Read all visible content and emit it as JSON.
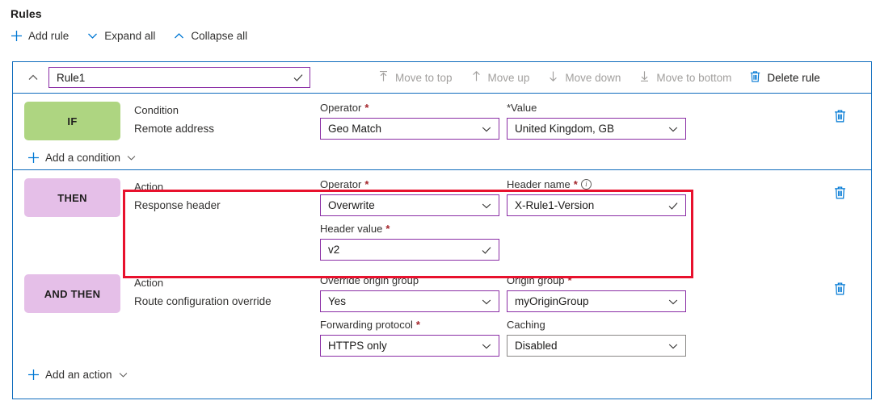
{
  "page": {
    "title": "Rules"
  },
  "command_bar": [
    {
      "label": "Add rule",
      "icon": "plus-icon"
    },
    {
      "label": "Expand all",
      "icon": "chevron-down-icon"
    },
    {
      "label": "Collapse all",
      "icon": "chevron-up-icon"
    }
  ],
  "rule": {
    "name_value": "Rule1",
    "name_status": "valid-checkmark",
    "collapse_icon": "chevron-up-icon",
    "header_actions": [
      {
        "label": "Move to top",
        "icon": "move-to-top-icon",
        "enabled": false
      },
      {
        "label": "Move up",
        "icon": "arrow-up-icon",
        "enabled": false
      },
      {
        "label": "Move down",
        "icon": "arrow-down-icon",
        "enabled": false
      },
      {
        "label": "Move to bottom",
        "icon": "move-to-bottom-icon",
        "enabled": false
      },
      {
        "label": "Delete rule",
        "icon": "trash-icon",
        "enabled": true
      }
    ]
  },
  "if_section": {
    "badge": "IF",
    "badge_color": "#aed581",
    "labels": {
      "kind": "Condition",
      "name": "Remote address"
    },
    "operator": {
      "label": "Operator",
      "required": true,
      "value": "Geo Match",
      "control": "dropdown"
    },
    "value": {
      "label": "*Value",
      "required_prefix": true,
      "value": "United Kingdom, GB",
      "control": "dropdown"
    },
    "add_link": {
      "label": "Add a condition",
      "plus_icon": "plus-icon",
      "chevron_icon": "chevron-down-icon"
    },
    "delete_icon": "trash-icon"
  },
  "then_section": {
    "badge": "THEN",
    "badge_color": "#e5bfe8",
    "labels": {
      "kind": "Action",
      "name": "Response header"
    },
    "operator": {
      "label": "Operator",
      "required": true,
      "value": "Overwrite",
      "control": "dropdown"
    },
    "header_value": {
      "label": "Header value",
      "required": true,
      "value": "v2",
      "control": "textfield-valid"
    },
    "header_name": {
      "label": "Header name",
      "required": true,
      "info_icon": "info-icon",
      "value": "X-Rule1-Version",
      "control": "textfield-valid"
    },
    "delete_icon": "trash-icon"
  },
  "and_then_section": {
    "badge": "AND THEN",
    "badge_color": "#e5bfe8",
    "labels": {
      "kind": "Action",
      "name": "Route configuration override"
    },
    "override_origin_group": {
      "label": "Override origin group",
      "required": false,
      "value": "Yes",
      "control": "dropdown"
    },
    "forwarding_protocol": {
      "label": "Forwarding protocol",
      "required": true,
      "value": "HTTPS only",
      "control": "dropdown"
    },
    "origin_group": {
      "label": "Origin group",
      "required": true,
      "value": "myOriginGroup",
      "control": "dropdown"
    },
    "caching": {
      "label": "Caching",
      "required": false,
      "value": "Disabled",
      "control": "dropdown",
      "border": "#8a8886"
    },
    "delete_icon": "trash-icon"
  },
  "footer": {
    "add_action": {
      "label": "Add an action",
      "plus_icon": "plus-icon",
      "chevron_icon": "chevron-down-icon"
    }
  },
  "annotation": {
    "color": "#e8112d",
    "shape": "rectangle-highlight"
  }
}
